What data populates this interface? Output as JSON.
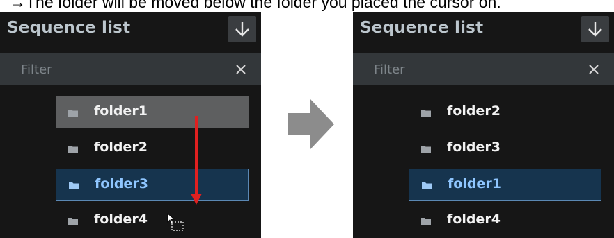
{
  "caption": "→The folder will be moved below the folder you placed the cursor on.",
  "panels": [
    {
      "title": "Sequence list",
      "filter_placeholder": "Filter",
      "items": [
        {
          "label": "folder1",
          "state": "dragging"
        },
        {
          "label": "folder2",
          "state": "normal"
        },
        {
          "label": "folder3",
          "state": "selected"
        },
        {
          "label": "folder4",
          "state": "normal"
        }
      ]
    },
    {
      "title": "Sequence list",
      "filter_placeholder": "Filter",
      "items": [
        {
          "label": "folder2",
          "state": "normal"
        },
        {
          "label": "folder3",
          "state": "normal"
        },
        {
          "label": "folder1",
          "state": "selected"
        },
        {
          "label": "folder4",
          "state": "normal"
        }
      ]
    }
  ],
  "icons": {
    "sort": "arrow-down-icon",
    "clear": "close-icon",
    "folder": "folder-icon",
    "drag": "drag-arrow-icon",
    "cursor": "drag-cursor-icon",
    "transition": "right-arrow-icon"
  },
  "colors": {
    "panel_bg": "#161616",
    "filter_bg": "#33373a",
    "selected_bg": "#16344e",
    "selected_border": "#5b88b4",
    "selected_text": "#8fc6ff",
    "dragging_bg": "#5e5f60",
    "drag_arrow": "#e02020",
    "transition_arrow": "#8c8c8c"
  }
}
